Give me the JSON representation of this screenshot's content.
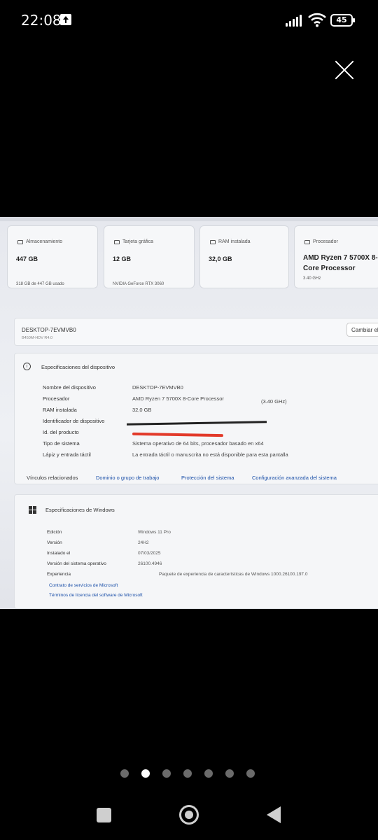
{
  "status_bar": {
    "time": "22:08",
    "battery": "45"
  },
  "pager": {
    "count": 7,
    "active_index": 1
  },
  "photo": {
    "cards": [
      {
        "label": "Almacenamiento",
        "value": "447 GB",
        "sub": "318 GB de 447 GB usado"
      },
      {
        "label": "Tarjeta gráfica",
        "value": "12 GB",
        "sub": "NVIDIA GeForce RTX 3060"
      },
      {
        "label": "RAM instalada",
        "value": "32,0 GB",
        "sub": ""
      },
      {
        "label": "Procesador",
        "value": "AMD Ryzen 7 5700X 8-Core Processor",
        "sub": "3.40 GHz"
      }
    ],
    "device": {
      "name": "DESKTOP-7EVMVB0",
      "model": "B450M-HDV R4.0",
      "rename": "Cambiar el"
    },
    "specs": {
      "title": "Especificaciones del dispositivo",
      "rows": [
        {
          "label": "Nombre del dispositivo",
          "value": "DESKTOP-7EVMVB0"
        },
        {
          "label": "Procesador",
          "value": "AMD Ryzen 7 5700X 8-Core Processor"
        },
        {
          "label": "RAM instalada",
          "value": "32,0 GB"
        },
        {
          "label": "Identificador de dispositivo",
          "value": ""
        },
        {
          "label": "Id. del producto",
          "value": ""
        },
        {
          "label": "Tipo de sistema",
          "value": "Sistema operativo de 64 bits, procesador basado en x64"
        },
        {
          "label": "Lápiz y entrada táctil",
          "value": "La entrada táctil o manuscrita no está disponible para esta pantalla"
        }
      ],
      "processor_speed": "(3.40 GHz)"
    },
    "links": {
      "label": "Vínculos relacionados",
      "items": [
        "Dominio o grupo de trabajo",
        "Protección del sistema",
        "Configuración avanzada del sistema"
      ]
    },
    "windows": {
      "title": "Especificaciones de Windows",
      "rows": [
        {
          "label": "Edición",
          "value": "Windows 11 Pro"
        },
        {
          "label": "Versión",
          "value": "24H2"
        },
        {
          "label": "Instalado el",
          "value": "07/03/2025"
        },
        {
          "label": "Versión del sistema operativo",
          "value": "26100.4946"
        },
        {
          "label": "Experiencia",
          "value": "Paquete de experiencia de características de Windows 1000.26100.197.0"
        }
      ],
      "links": [
        "Contrato de servicios de Microsoft",
        "Términos de licencia del software de Microsoft"
      ]
    }
  }
}
